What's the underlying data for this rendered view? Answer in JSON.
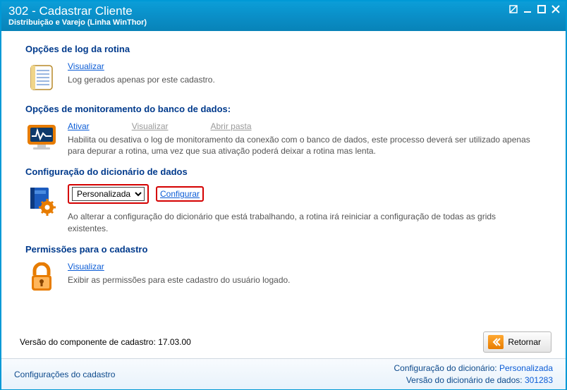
{
  "window": {
    "title": "302 - Cadastrar Cliente",
    "subtitle": "Distribuição e Varejo (Linha WinThor)"
  },
  "sections": {
    "log": {
      "title": "Opções de log da rotina",
      "visualizar": "Visualizar",
      "desc": "Log gerados apenas por este cadastro."
    },
    "monitor": {
      "title": "Opções de monitoramento do banco de dados:",
      "ativar": "Ativar",
      "visualizar": "Visualizar",
      "abrir_pasta": "Abrir pasta",
      "desc": "Habilita ou desativa o log de monitoramento da conexão com o banco de dados, este processo deverá ser utilizado apenas para depurar a rotina, uma vez que sua ativação poderá deixar a rotina mas lenta."
    },
    "dicionario": {
      "title": "Configuração do dicionário de dados",
      "select_value": "Personalizada",
      "configurar": "Configurar",
      "desc": "Ao alterar a configuração do dicionário que está trabalhando, a rotina irá reiniciar a configuração de todas as grids existentes."
    },
    "permissoes": {
      "title": "Permissões para o cadastro",
      "visualizar": "Visualizar",
      "desc": "Exibir as permissões para este cadastro do usuário logado."
    }
  },
  "footer": {
    "versao_componente_label": "Versão do componente de cadastro: ",
    "versao_componente_value": "17.03.00",
    "retornar": "Retornar"
  },
  "status": {
    "left": "Configurações do cadastro",
    "config_label": "Configuração do dicionário: ",
    "config_value": "Personalizada",
    "versao_label": "Versão do dicionário de dados: ",
    "versao_value": "301283"
  }
}
